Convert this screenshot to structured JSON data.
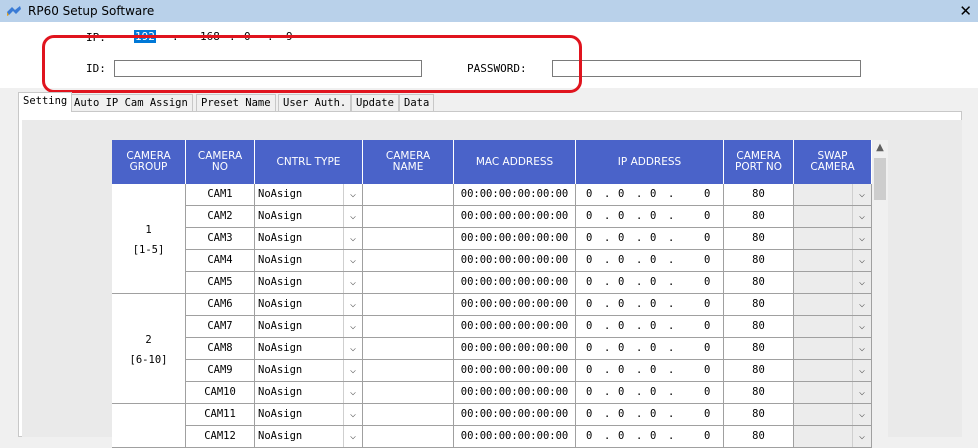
{
  "window": {
    "title": "RP60 Setup Software",
    "close_glyph": "✕",
    "icon": "app-icon"
  },
  "connection": {
    "ip_label": "IP:",
    "ip": [
      "192",
      "168",
      "0",
      "9"
    ],
    "ip_dot": ".",
    "id_label": "ID:",
    "id_value": "",
    "password_label": "PASSWORD:",
    "password_value": ""
  },
  "tabs": [
    "Setting",
    "Auto IP Cam Assign",
    "Preset Name",
    "User Auth.",
    "Update",
    "Data"
  ],
  "active_tab": "Setting",
  "table": {
    "headers": [
      "CAMERA\nGROUP",
      "CAMERA\nNO",
      "CNTRL TYPE",
      "CAMERA\nNAME",
      "MAC ADDRESS",
      "IP ADDRESS",
      "CAMERA\nPORT NO",
      "SWAP\nCAMERA"
    ],
    "groups": [
      {
        "number": "1",
        "range": "[1-5]"
      },
      {
        "number": "2",
        "range": "[6-10]"
      }
    ],
    "rows": [
      {
        "cam": "CAM1",
        "type": "NoAsign",
        "name": "",
        "mac": "00:00:00:00:00:00",
        "ip": [
          "0",
          "0",
          "0",
          "0"
        ],
        "port": "80",
        "swap": ""
      },
      {
        "cam": "CAM2",
        "type": "NoAsign",
        "name": "",
        "mac": "00:00:00:00:00:00",
        "ip": [
          "0",
          "0",
          "0",
          "0"
        ],
        "port": "80",
        "swap": ""
      },
      {
        "cam": "CAM3",
        "type": "NoAsign",
        "name": "",
        "mac": "00:00:00:00:00:00",
        "ip": [
          "0",
          "0",
          "0",
          "0"
        ],
        "port": "80",
        "swap": ""
      },
      {
        "cam": "CAM4",
        "type": "NoAsign",
        "name": "",
        "mac": "00:00:00:00:00:00",
        "ip": [
          "0",
          "0",
          "0",
          "0"
        ],
        "port": "80",
        "swap": ""
      },
      {
        "cam": "CAM5",
        "type": "NoAsign",
        "name": "",
        "mac": "00:00:00:00:00:00",
        "ip": [
          "0",
          "0",
          "0",
          "0"
        ],
        "port": "80",
        "swap": ""
      },
      {
        "cam": "CAM6",
        "type": "NoAsign",
        "name": "",
        "mac": "00:00:00:00:00:00",
        "ip": [
          "0",
          "0",
          "0",
          "0"
        ],
        "port": "80",
        "swap": ""
      },
      {
        "cam": "CAM7",
        "type": "NoAsign",
        "name": "",
        "mac": "00:00:00:00:00:00",
        "ip": [
          "0",
          "0",
          "0",
          "0"
        ],
        "port": "80",
        "swap": ""
      },
      {
        "cam": "CAM8",
        "type": "NoAsign",
        "name": "",
        "mac": "00:00:00:00:00:00",
        "ip": [
          "0",
          "0",
          "0",
          "0"
        ],
        "port": "80",
        "swap": ""
      },
      {
        "cam": "CAM9",
        "type": "NoAsign",
        "name": "",
        "mac": "00:00:00:00:00:00",
        "ip": [
          "0",
          "0",
          "0",
          "0"
        ],
        "port": "80",
        "swap": ""
      },
      {
        "cam": "CAM10",
        "type": "NoAsign",
        "name": "",
        "mac": "00:00:00:00:00:00",
        "ip": [
          "0",
          "0",
          "0",
          "0"
        ],
        "port": "80",
        "swap": ""
      },
      {
        "cam": "CAM11",
        "type": "NoAsign",
        "name": "",
        "mac": "00:00:00:00:00:00",
        "ip": [
          "0",
          "0",
          "0",
          "0"
        ],
        "port": "80",
        "swap": ""
      },
      {
        "cam": "CAM12",
        "type": "NoAsign",
        "name": "",
        "mac": "00:00:00:00:00:00",
        "ip": [
          "0",
          "0",
          "0",
          "0"
        ],
        "port": "80",
        "swap": ""
      }
    ],
    "dropdown_arrow": "⌵",
    "scroll_up": "▲"
  },
  "colors": {
    "header_bg": "#4a63c9",
    "highlight": "#e0141e",
    "selection": "#0078d7"
  }
}
